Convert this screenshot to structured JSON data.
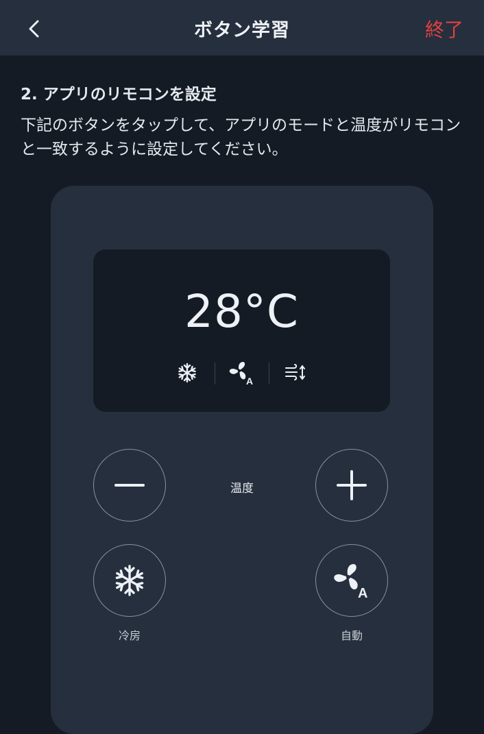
{
  "header": {
    "title": "ボタン学習",
    "done_label": "終了",
    "back_icon": "chevron-left-icon",
    "done_color": "#e5403e"
  },
  "instructions": {
    "title": "2. アプリのリモコンを設定",
    "description": "下記のボタンをタップして、アプリのモードと温度がリモコンと一致するように設定してください。"
  },
  "display": {
    "temperature": "28°C",
    "mode_icon": "snowflake-icon",
    "fan_icon": "fan-auto-icon",
    "fan_badge": "A",
    "swing_icon": "swing-icon"
  },
  "controls": {
    "temp_label": "温度",
    "minus_icon": "minus-icon",
    "plus_icon": "plus-icon",
    "mode_label": "冷房",
    "fan_label": "自動",
    "fan_badge": "A"
  }
}
